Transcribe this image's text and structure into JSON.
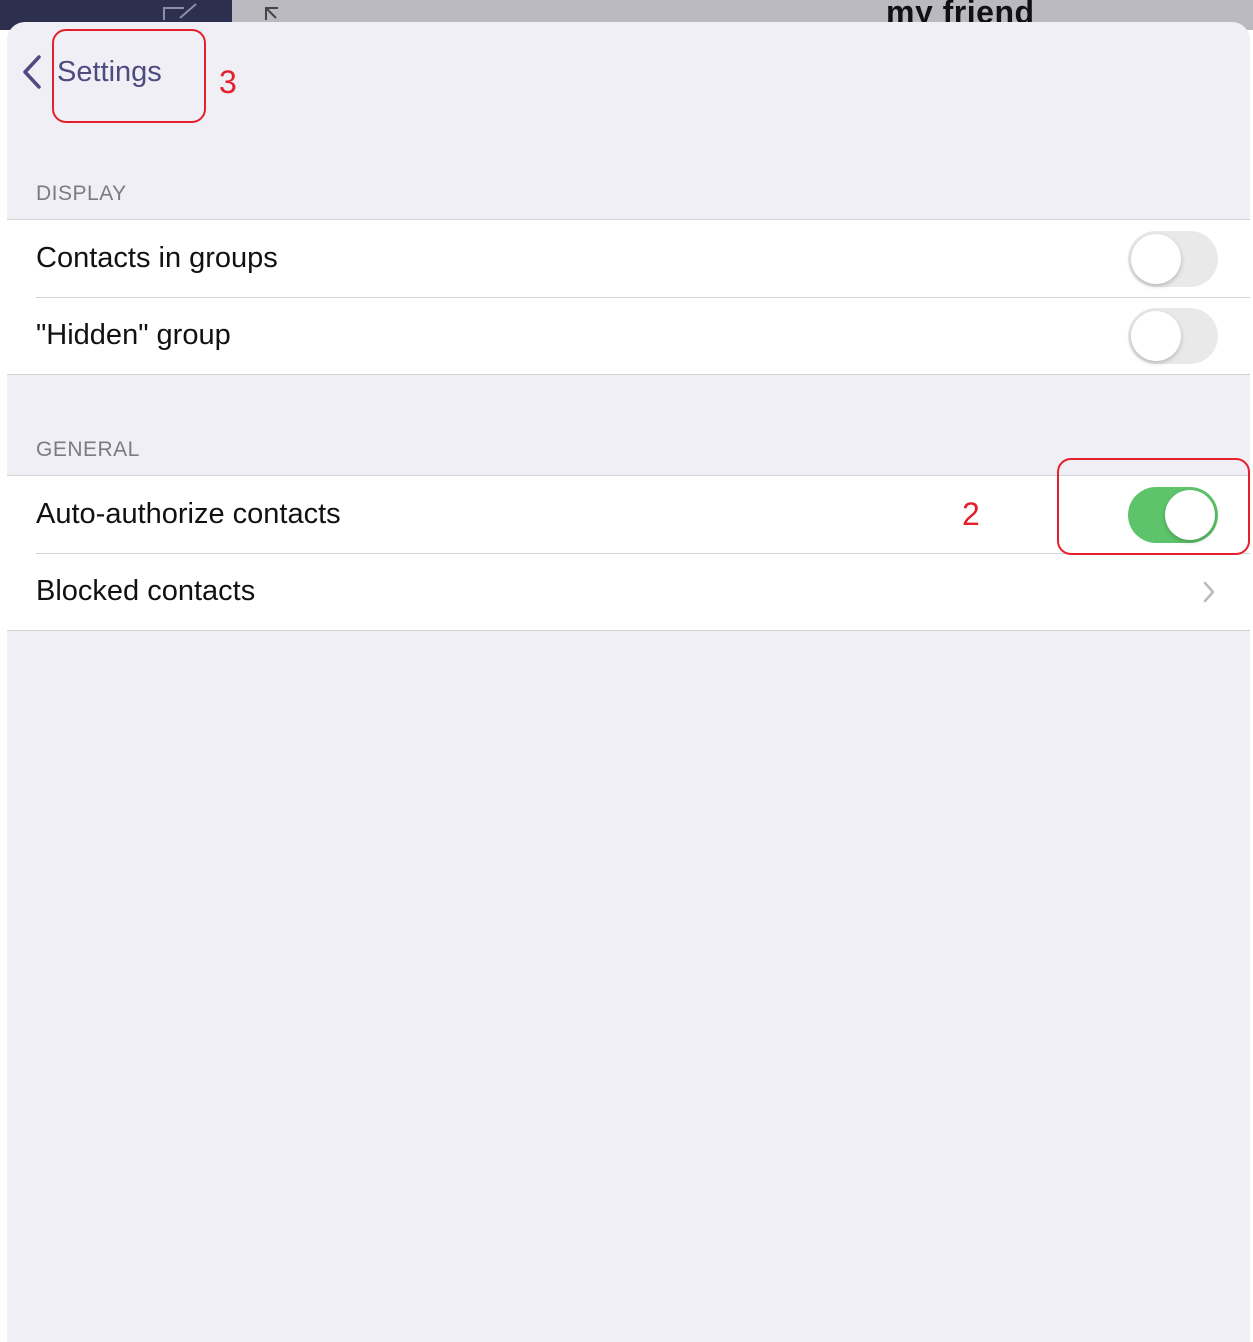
{
  "background": {
    "title": "my friend"
  },
  "nav": {
    "back_label": "Settings"
  },
  "sections": {
    "display": {
      "header": "DISPLAY",
      "rows": [
        {
          "label": "Contacts in groups",
          "toggle_on": false
        },
        {
          "label": "\"Hidden\" group",
          "toggle_on": false
        }
      ]
    },
    "general": {
      "header": "GENERAL",
      "rows": [
        {
          "label": "Auto-authorize contacts",
          "toggle_on": true
        },
        {
          "label": "Blocked contacts",
          "accessory": "chevron-right-icon"
        }
      ]
    }
  },
  "annotations": {
    "toggle_marker": "2",
    "back_marker": "3"
  },
  "colors": {
    "accent": "#4f4a80",
    "toggle_on": "#5ec46b",
    "annotation": "#e3202c",
    "background": "#f0eff5"
  }
}
